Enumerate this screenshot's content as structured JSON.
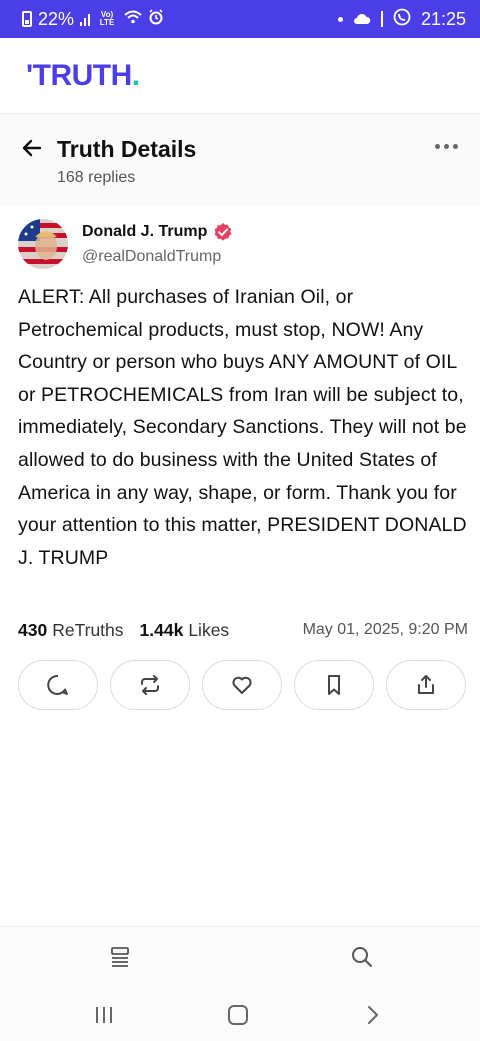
{
  "status_bar": {
    "battery": "22%",
    "network": "Vo) LTE",
    "time": "21:25"
  },
  "app": {
    "logo_text": "TRUTH",
    "logo_dot": "."
  },
  "details_header": {
    "title": "Truth Details",
    "replies": "168 replies"
  },
  "post": {
    "author_name": "Donald J. Trump",
    "author_handle": "@realDonaldTrump",
    "text": "ALERT: All purchases of Iranian Oil, or Petrochemical products, must stop, NOW! Any Country or person who buys ANY AMOUNT of OIL or PETROCHEMICALS from Iran will be subject to, immediately, Secondary Sanctions. They will not be allowed to do business with the United States of America in any way, shape, or form. Thank you for your attention to this matter, PRESIDENT DONALD J. TRUMP",
    "retruths_count": "430",
    "retruths_label": "ReTruths",
    "likes_count": "1.44k",
    "likes_label": "Likes",
    "timestamp": "May 01, 2025, 9:20 PM"
  },
  "actions": [
    "reply-icon",
    "retruth-icon",
    "like-icon",
    "bookmark-icon",
    "share-icon"
  ],
  "colors": {
    "brand": "#4b3ee6",
    "accent": "#17c7b0",
    "verified": "#e8405e"
  }
}
